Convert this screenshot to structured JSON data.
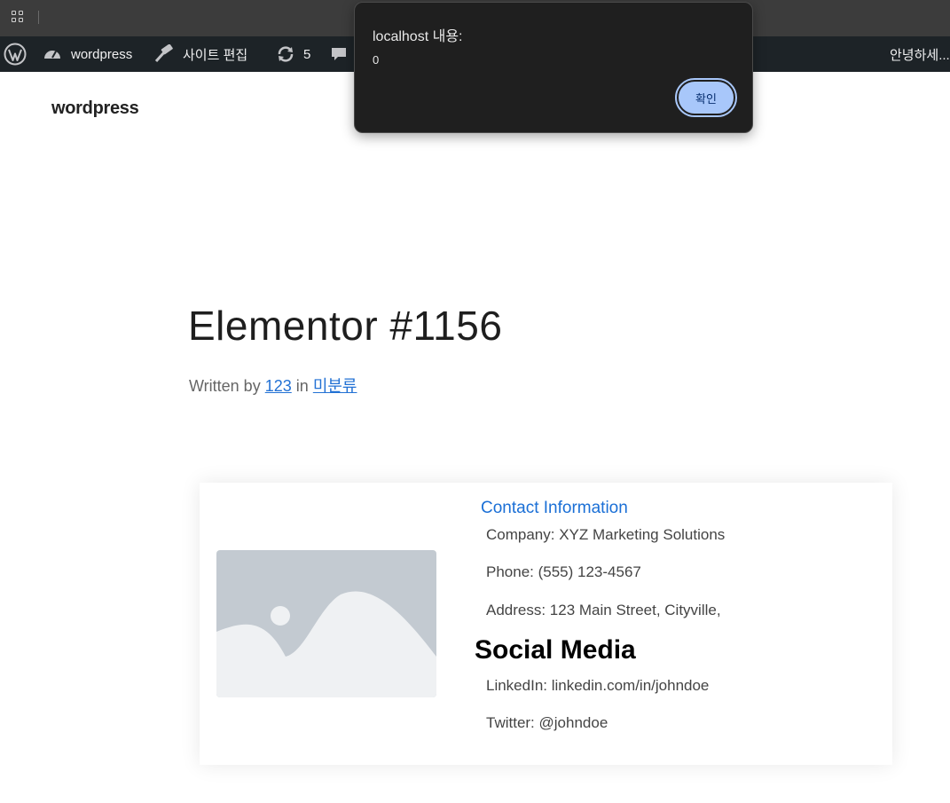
{
  "admin_bar": {
    "site_name": "wordpress",
    "edit_site": "사이트 편집",
    "updates_count": "5",
    "greeting": "안녕하세..."
  },
  "site": {
    "title": "wordpress"
  },
  "post": {
    "title": "Elementor #1156",
    "written_by": "Written by",
    "author": "123",
    "in": "in",
    "category": "미분류"
  },
  "card": {
    "contact_heading": "Contact Information",
    "company": "Company: XYZ Marketing Solutions",
    "phone": "Phone: (555) 123-4567",
    "address": "Address: 123 Main Street, Cityville,",
    "social_heading": "Social Media",
    "linkedin": "LinkedIn: linkedin.com/in/johndoe",
    "twitter": "Twitter: @johndoe"
  },
  "dialog": {
    "title": "localhost 내용:",
    "message": "0",
    "ok_label": "확인"
  },
  "colors": {
    "admin_bar_bg": "#1d2327",
    "link": "#2271d4",
    "dialog_bg": "#1f1f1f",
    "dialog_button": "#a8c7fa"
  }
}
